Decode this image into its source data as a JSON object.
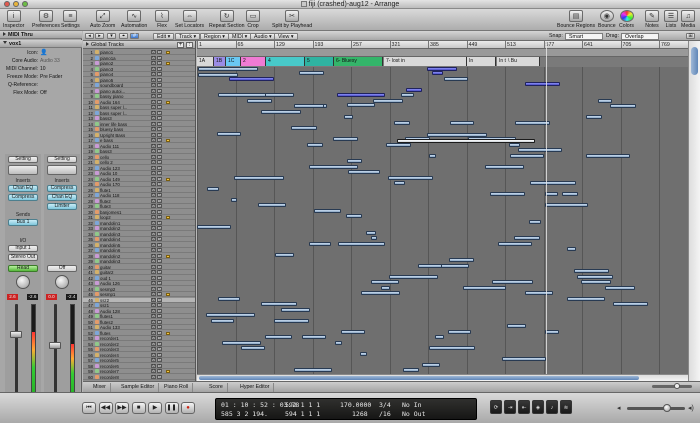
{
  "window": {
    "title": "fiji (crashed)-aug12 - Arrange"
  },
  "toolbar": {
    "left": [
      {
        "label": "Inspector",
        "icon": "inspector-icon",
        "glyph": "i"
      },
      {
        "label": "Preferences",
        "icon": "preferences-icon",
        "glyph": "⚙"
      },
      {
        "label": "Settings",
        "icon": "settings-icon",
        "glyph": "≡"
      }
    ],
    "center": [
      {
        "label": "Auto Zoom",
        "icon": "auto-zoom-icon",
        "glyph": "⤢"
      },
      {
        "label": "Automation",
        "icon": "automation-icon",
        "glyph": "∿"
      },
      {
        "label": "Flex",
        "icon": "flex-icon",
        "glyph": "⌇"
      },
      {
        "label": "Set Locators",
        "icon": "set-locators-icon",
        "glyph": "⇔"
      },
      {
        "label": "Repeat Section",
        "icon": "repeat-section-icon",
        "glyph": "↻"
      },
      {
        "label": "Crop",
        "icon": "crop-icon",
        "glyph": "▭"
      },
      {
        "label": "Split by Playhead",
        "icon": "split-icon",
        "glyph": "✂"
      }
    ],
    "right": [
      {
        "label": "Bounce Regions",
        "icon": "bounce-regions-icon",
        "glyph": "▤"
      },
      {
        "label": "Bounce",
        "icon": "bounce-icon",
        "glyph": "◉"
      },
      {
        "label": "Colors",
        "icon": "colors-icon",
        "glyph": ""
      },
      {
        "label": "Notes",
        "icon": "notes-icon",
        "glyph": "✎"
      },
      {
        "label": "Lists",
        "icon": "lists-icon",
        "glyph": "☰"
      },
      {
        "label": "Media",
        "icon": "media-icon",
        "glyph": "♫"
      }
    ]
  },
  "inspector": {
    "midi_thru": "MIDI Thru",
    "track_name": "vox1",
    "params": [
      {
        "key": "Icon:",
        "value": ""
      },
      {
        "key": "Core Audio:",
        "value": "Audio 33"
      },
      {
        "key": "MIDI Channel:",
        "value": "10"
      },
      {
        "key": "Freeze Mode:",
        "value": "Pre Fader"
      },
      {
        "key": "Q-Reference:",
        "value": ""
      },
      {
        "key": "Flex Mode:",
        "value": "Off"
      }
    ],
    "strip1": {
      "setting": "Setting",
      "inserts_label": "Inserts",
      "inserts": [
        "Chan EQ",
        "Compress"
      ],
      "sends_label": "Sends",
      "send": "Bus 1",
      "io_label": "I/O",
      "input": "Input 1",
      "output": "Stereo Out",
      "automation": "Read",
      "vol": "-2.6",
      "peak": "2.6",
      "name": "vox1",
      "level": 0.72
    },
    "strip2": {
      "setting": "Setting",
      "inserts_label": "Inserts",
      "inserts": [
        "Compress",
        "Chan EQ",
        "Limiter"
      ],
      "automation": "Off",
      "vol": "-2.4",
      "peak": "0.0",
      "name": "Stereo Out",
      "level": 0.6
    },
    "mute": "M",
    "solo": "S"
  },
  "arrange_header": {
    "menus": [
      "Edit",
      "Track",
      "Region",
      "MIDI",
      "Audio",
      "View"
    ],
    "snap_label": "Snap:",
    "snap_value": "Smart",
    "drag_label": "Drag:",
    "drag_value": "Overlap"
  },
  "global_tracks": "Global Tracks",
  "ruler_ticks": [
    "1",
    "65",
    "129",
    "193",
    "257",
    "321",
    "385",
    "449",
    "513",
    "577",
    "641",
    "705",
    "769"
  ],
  "markers": [
    {
      "label": "1A",
      "color": "#d8d8d8",
      "start": 0,
      "end": 0.035
    },
    {
      "label": "1B",
      "color": "#9a8ce6",
      "start": 0.035,
      "end": 0.06
    },
    {
      "label": "1C",
      "color": "#6ac8f2",
      "start": 0.06,
      "end": 0.09
    },
    {
      "label": "2",
      "color": "#ef7bd4",
      "start": 0.09,
      "end": 0.14
    },
    {
      "label": "4",
      "color": "#48c9c9",
      "start": 0.14,
      "end": 0.22
    },
    {
      "label": "5",
      "color": "#2fb3a1",
      "start": 0.22,
      "end": 0.28
    },
    {
      "label": "6- Bluesy",
      "color": "#34b56a",
      "start": 0.28,
      "end": 0.38
    },
    {
      "label": "7- lost in",
      "color": "#d9d9d9",
      "start": 0.38,
      "end": 0.55
    },
    {
      "label": "In",
      "color": "#d9d9d9",
      "start": 0.55,
      "end": 0.61
    },
    {
      "label": "In thin",
      "color": "#d9d9d9",
      "start": 0.61,
      "end": 0.63
    },
    {
      "label": "\\ Bu",
      "color": "#d9d9d9",
      "start": 0.63,
      "end": 0.7
    }
  ],
  "tracks": [
    "piano1",
    "piano1a",
    "piano2",
    "piano3",
    "piano4",
    "piano5",
    "soundboard",
    "piano autoi...",
    "bassy piano",
    "Audio 164",
    "bass super l...",
    "bass super l...",
    "bass3",
    "inner life bass",
    "bluesy bass",
    "Upright Bass",
    "e bass",
    "Audio 111",
    "bass3",
    "cello",
    "cello 2",
    "Audio 123",
    "Audio 10",
    "Audio 149",
    "Audio 170",
    "flute1",
    "Audio 118",
    "flute2",
    "flute3",
    "banjomes1",
    "loop2",
    "mandolin1",
    "mandolin2",
    "mandolin3",
    "mandolin4",
    "mandolin5",
    "mandolin6",
    "mandolin2",
    "mandolin3",
    "guitar",
    "guitar2",
    "oud 1",
    "Audio 126",
    "sesmp2",
    "sesmp1",
    "ssz2",
    "ssz1",
    "Audio 128",
    "flutes1",
    "flutes2",
    "Audio 133",
    "flutes",
    "recorder1",
    "recorder2",
    "recorder3",
    "recorder4",
    "recorder5",
    "recorder6",
    "recorder7",
    "recorder8"
  ],
  "bottom_tabs": [
    "Mixer",
    "Sample Editor",
    "Piano Roll",
    "Score",
    "Hyper Editor"
  ],
  "transport": {
    "buttons": [
      {
        "name": "go-to-beginning",
        "glyph": "⏮"
      },
      {
        "name": "rewind",
        "glyph": "◀◀"
      },
      {
        "name": "forward",
        "glyph": "▶▶"
      },
      {
        "name": "stop",
        "glyph": "■"
      },
      {
        "name": "play",
        "glyph": "▶"
      },
      {
        "name": "pause",
        "glyph": "❚❚"
      },
      {
        "name": "record",
        "glyph": "●"
      }
    ],
    "time": "01 : 10 : 52 : 03.78",
    "bars": "585   3   2   194.",
    "left_locator": "592   1   1   1",
    "right_locator": "594   1   1   1",
    "tempo": "170.0000",
    "tempo_sub": "1268",
    "sig": "3/4",
    "div": "/16",
    "in": "No In",
    "out": "No Out",
    "right_buttons": [
      "⟳",
      "⇥",
      "⇤",
      "◈",
      "♪",
      "≋"
    ]
  }
}
